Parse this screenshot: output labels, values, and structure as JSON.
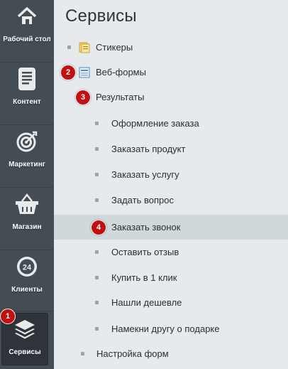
{
  "sidebar": {
    "items": [
      {
        "id": "desktop",
        "label": "Рабочий стол",
        "icon": "home-icon"
      },
      {
        "id": "content",
        "label": "Контент",
        "icon": "document-icon"
      },
      {
        "id": "marketing",
        "label": "Маркетинг",
        "icon": "target-icon"
      },
      {
        "id": "shop",
        "label": "Магазин",
        "icon": "basket-icon"
      },
      {
        "id": "clients",
        "label": "Клиенты",
        "icon": "clients-24-icon",
        "icon_text": "24"
      },
      {
        "id": "services",
        "label": "Сервисы",
        "icon": "layers-icon",
        "active": true
      }
    ]
  },
  "panel": {
    "title": "Сервисы",
    "items": [
      {
        "label": "Стикеры",
        "icon": "stickers-icon"
      },
      {
        "label": "Веб-формы",
        "icon": "webform-icon"
      },
      {
        "label": "Результаты"
      },
      {
        "label": "Оформление заказа"
      },
      {
        "label": "Заказать продукт"
      },
      {
        "label": "Заказать услугу"
      },
      {
        "label": "Задать вопрос"
      },
      {
        "label": "Заказать звонок",
        "selected": true
      },
      {
        "label": "Оставить отзыв"
      },
      {
        "label": "Купить в 1 клик"
      },
      {
        "label": "Нашли дешевле"
      },
      {
        "label": "Намекни другу о подарке"
      },
      {
        "label": "Настройка форм"
      }
    ]
  },
  "annotations": [
    "1",
    "2",
    "3",
    "4"
  ],
  "colors": {
    "rail": "#444c54",
    "rail_active": "#2e3439",
    "panel": "#e6eaec",
    "selected_row": "#cfd9db",
    "badge": "#c1100f"
  }
}
